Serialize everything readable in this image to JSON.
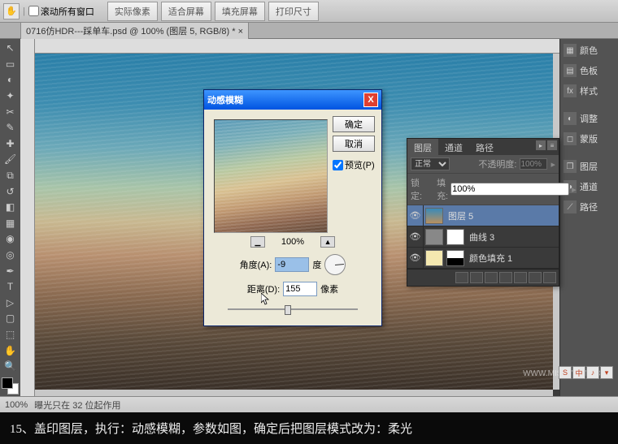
{
  "topbar": {
    "scroll_all_label": "滚动所有窗口",
    "btn_actual": "实际像素",
    "btn_fit": "适合屏幕",
    "btn_fill": "填充屏幕",
    "btn_print": "打印尺寸"
  },
  "tab": {
    "title": "0716仿HDR---踩单车.psd @ 100% (图层 5, RGB/8) *"
  },
  "dialog": {
    "title": "动感模糊",
    "ok": "确定",
    "cancel": "取消",
    "preview_chk": "预览(P)",
    "zoom": "100%",
    "angle_label": "角度(A):",
    "angle_value": "-9",
    "angle_unit": "度",
    "distance_label": "距离(D):",
    "distance_value": "155",
    "distance_unit": "像素"
  },
  "layers": {
    "tab_layers": "图层",
    "tab_channels": "通道",
    "tab_paths": "路径",
    "mode": "正常",
    "opacity_label": "不透明度:",
    "opacity_value": "100%",
    "lock_label": "锁定:",
    "fill_label": "填充:",
    "fill_value": "100%",
    "items": [
      {
        "name": "图层 5"
      },
      {
        "name": "曲线 3"
      },
      {
        "name": "颜色填充 1"
      }
    ]
  },
  "dock": {
    "color": "颜色",
    "swatches": "色板",
    "styles": "样式",
    "adjust": "调整",
    "mask": "蒙版",
    "layers": "图层",
    "channels": "通道",
    "paths": "路径"
  },
  "status": {
    "zoom": "100%",
    "info": "曝光只在 32 位起作用"
  },
  "caption": "15、盖印图层，执行：动感模糊，参数如图，确定后把图层模式改为：柔光",
  "watermark": "WWW.MISSYUAN.COM",
  "ime": {
    "a": "S",
    "b": "中",
    "c": "♪",
    "d": "▾"
  }
}
